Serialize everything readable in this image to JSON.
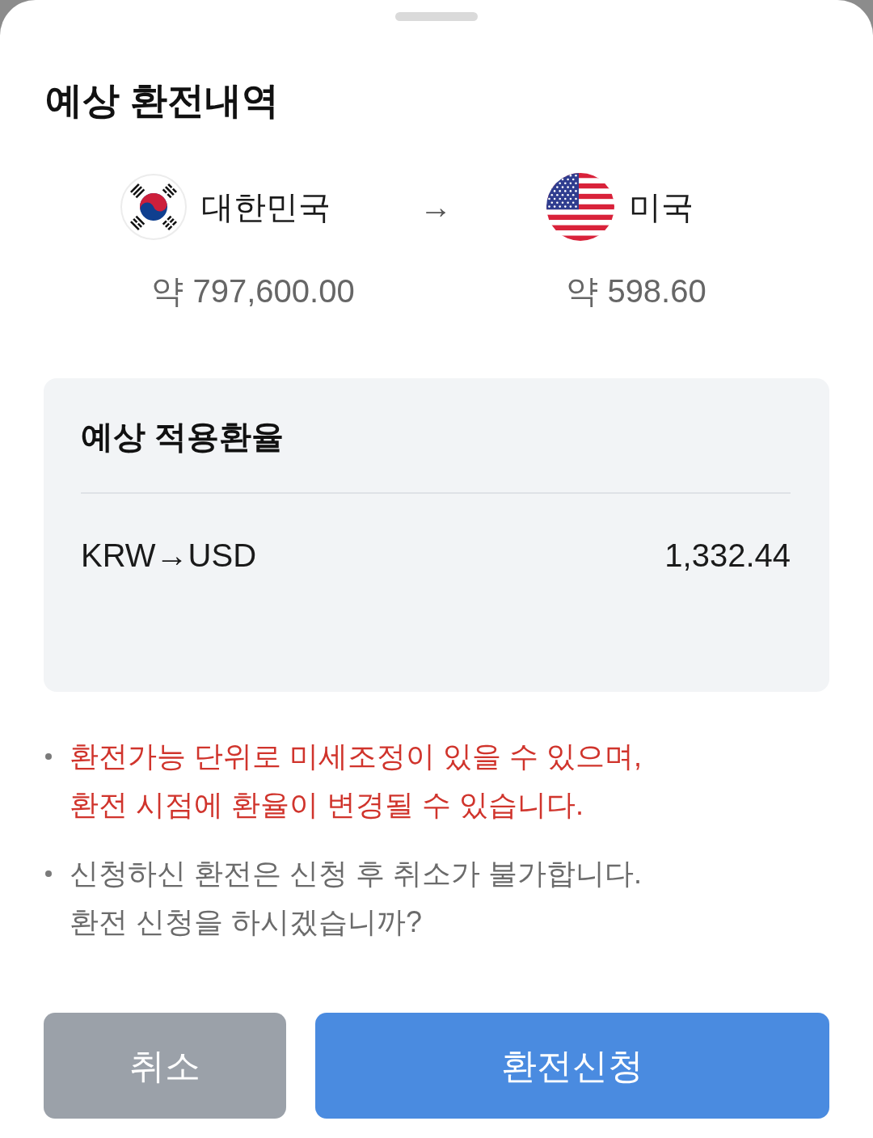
{
  "title": "예상 환전내역",
  "exchange": {
    "from": {
      "country": "대한민국",
      "amount": "약 797,600.00"
    },
    "arrow": "→",
    "to": {
      "country": "미국",
      "amount": "약 598.60"
    }
  },
  "rate_card": {
    "title": "예상 적용환율",
    "rows": [
      {
        "pair": "KRW→USD",
        "rate": "1,332.44"
      }
    ]
  },
  "notes": [
    {
      "kind": "warning",
      "text": "환전가능 단위로 미세조정이 있을 수 있으며,\n환전 시점에 환율이 변경될 수 있습니다."
    },
    {
      "kind": "info",
      "text": "신청하신 환전은 신청 후 취소가 불가합니다.\n환전 신청을 하시겠습니까?"
    }
  ],
  "buttons": [
    {
      "kind": "secondary",
      "label": "취소"
    },
    {
      "kind": "primary",
      "label": "환전신청"
    }
  ]
}
